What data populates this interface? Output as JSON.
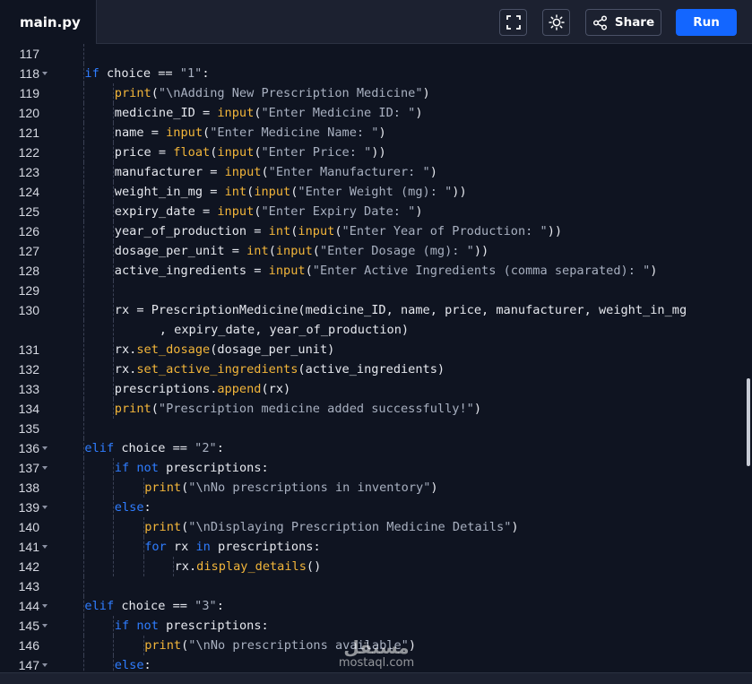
{
  "header": {
    "file_tab": "main.py",
    "share_label": "Share",
    "run_label": "Run",
    "icons": {
      "fullscreen": "fullscreen-icon",
      "theme": "sun-icon",
      "share": "share-icon"
    }
  },
  "colors": {
    "keyword": "#2f7dff",
    "function": "#f2b53a",
    "string": "#a8b0c0",
    "run_button": "#1366ff"
  },
  "watermark": {
    "logo": "مستقل",
    "text": "mostaql.com"
  },
  "code_lines": [
    {
      "n": "117",
      "fold": false,
      "indent": 1,
      "tokens": []
    },
    {
      "n": "118",
      "fold": true,
      "indent": 1,
      "tokens": [
        [
          "kw",
          "if"
        ],
        [
          "op",
          " choice == "
        ],
        [
          "st",
          "\"1\""
        ],
        [
          "op",
          ":"
        ]
      ]
    },
    {
      "n": "119",
      "fold": false,
      "indent": 2,
      "tokens": [
        [
          "fn",
          "print"
        ],
        [
          "op",
          "("
        ],
        [
          "st",
          "\"\\nAdding New Prescription Medicine\""
        ],
        [
          "op",
          ")"
        ]
      ]
    },
    {
      "n": "120",
      "fold": false,
      "indent": 2,
      "tokens": [
        [
          "op",
          "medicine_ID = "
        ],
        [
          "fn",
          "input"
        ],
        [
          "op",
          "("
        ],
        [
          "st",
          "\"Enter Medicine ID: \""
        ],
        [
          "op",
          ")"
        ]
      ]
    },
    {
      "n": "121",
      "fold": false,
      "indent": 2,
      "tokens": [
        [
          "op",
          "name = "
        ],
        [
          "fn",
          "input"
        ],
        [
          "op",
          "("
        ],
        [
          "st",
          "\"Enter Medicine Name: \""
        ],
        [
          "op",
          ")"
        ]
      ]
    },
    {
      "n": "122",
      "fold": false,
      "indent": 2,
      "tokens": [
        [
          "op",
          "price = "
        ],
        [
          "fn",
          "float"
        ],
        [
          "op",
          "("
        ],
        [
          "fn",
          "input"
        ],
        [
          "op",
          "("
        ],
        [
          "st",
          "\"Enter Price: \""
        ],
        [
          "op",
          "))"
        ]
      ]
    },
    {
      "n": "123",
      "fold": false,
      "indent": 2,
      "tokens": [
        [
          "op",
          "manufacturer = "
        ],
        [
          "fn",
          "input"
        ],
        [
          "op",
          "("
        ],
        [
          "st",
          "\"Enter Manufacturer: \""
        ],
        [
          "op",
          ")"
        ]
      ]
    },
    {
      "n": "124",
      "fold": false,
      "indent": 2,
      "tokens": [
        [
          "op",
          "weight_in_mg = "
        ],
        [
          "fn",
          "int"
        ],
        [
          "op",
          "("
        ],
        [
          "fn",
          "input"
        ],
        [
          "op",
          "("
        ],
        [
          "st",
          "\"Enter Weight (mg): \""
        ],
        [
          "op",
          "))"
        ]
      ]
    },
    {
      "n": "125",
      "fold": false,
      "indent": 2,
      "tokens": [
        [
          "op",
          "expiry_date = "
        ],
        [
          "fn",
          "input"
        ],
        [
          "op",
          "("
        ],
        [
          "st",
          "\"Enter Expiry Date: \""
        ],
        [
          "op",
          ")"
        ]
      ]
    },
    {
      "n": "126",
      "fold": false,
      "indent": 2,
      "tokens": [
        [
          "op",
          "year_of_production = "
        ],
        [
          "fn",
          "int"
        ],
        [
          "op",
          "("
        ],
        [
          "fn",
          "input"
        ],
        [
          "op",
          "("
        ],
        [
          "st",
          "\"Enter Year of Production: \""
        ],
        [
          "op",
          "))"
        ]
      ]
    },
    {
      "n": "127",
      "fold": false,
      "indent": 2,
      "tokens": [
        [
          "op",
          "dosage_per_unit = "
        ],
        [
          "fn",
          "int"
        ],
        [
          "op",
          "("
        ],
        [
          "fn",
          "input"
        ],
        [
          "op",
          "("
        ],
        [
          "st",
          "\"Enter Dosage (mg): \""
        ],
        [
          "op",
          "))"
        ]
      ]
    },
    {
      "n": "128",
      "fold": false,
      "indent": 2,
      "tokens": [
        [
          "op",
          "active_ingredients = "
        ],
        [
          "fn",
          "input"
        ],
        [
          "op",
          "("
        ],
        [
          "st",
          "\"Enter Active Ingredients (comma separated): \""
        ],
        [
          "op",
          ")"
        ]
      ]
    },
    {
      "n": "129",
      "fold": false,
      "indent": 2,
      "tokens": []
    },
    {
      "n": "130",
      "fold": false,
      "indent": 2,
      "tokens": [
        [
          "op",
          "rx = PrescriptionMedicine(medicine_ID, name, price, manufacturer, weight_in_mg"
        ]
      ]
    },
    {
      "n": "",
      "fold": false,
      "indent": 2,
      "wrap": true,
      "tokens": [
        [
          "op",
          ", expiry_date, year_of_production)"
        ]
      ]
    },
    {
      "n": "131",
      "fold": false,
      "indent": 2,
      "tokens": [
        [
          "op",
          "rx."
        ],
        [
          "fn",
          "set_dosage"
        ],
        [
          "op",
          "(dosage_per_unit)"
        ]
      ]
    },
    {
      "n": "132",
      "fold": false,
      "indent": 2,
      "tokens": [
        [
          "op",
          "rx."
        ],
        [
          "fn",
          "set_active_ingredients"
        ],
        [
          "op",
          "(active_ingredients)"
        ]
      ]
    },
    {
      "n": "133",
      "fold": false,
      "indent": 2,
      "tokens": [
        [
          "op",
          "prescriptions."
        ],
        [
          "fn",
          "append"
        ],
        [
          "op",
          "(rx)"
        ]
      ]
    },
    {
      "n": "134",
      "fold": false,
      "indent": 2,
      "tokens": [
        [
          "fn",
          "print"
        ],
        [
          "op",
          "("
        ],
        [
          "st",
          "\"Prescription medicine added successfully!\""
        ],
        [
          "op",
          ")"
        ]
      ]
    },
    {
      "n": "135",
      "fold": false,
      "indent": 1,
      "tokens": []
    },
    {
      "n": "136",
      "fold": true,
      "indent": 1,
      "tokens": [
        [
          "kw",
          "elif"
        ],
        [
          "op",
          " choice == "
        ],
        [
          "st",
          "\"2\""
        ],
        [
          "op",
          ":"
        ]
      ]
    },
    {
      "n": "137",
      "fold": true,
      "indent": 2,
      "tokens": [
        [
          "kw",
          "if"
        ],
        [
          "op",
          " "
        ],
        [
          "kw",
          "not"
        ],
        [
          "op",
          " prescriptions:"
        ]
      ]
    },
    {
      "n": "138",
      "fold": false,
      "indent": 3,
      "tokens": [
        [
          "fn",
          "print"
        ],
        [
          "op",
          "("
        ],
        [
          "st",
          "\"\\nNo prescriptions in inventory\""
        ],
        [
          "op",
          ")"
        ]
      ]
    },
    {
      "n": "139",
      "fold": true,
      "indent": 2,
      "tokens": [
        [
          "kw",
          "else"
        ],
        [
          "op",
          ":"
        ]
      ]
    },
    {
      "n": "140",
      "fold": false,
      "indent": 3,
      "tokens": [
        [
          "fn",
          "print"
        ],
        [
          "op",
          "("
        ],
        [
          "st",
          "\"\\nDisplaying Prescription Medicine Details\""
        ],
        [
          "op",
          ")"
        ]
      ]
    },
    {
      "n": "141",
      "fold": true,
      "indent": 3,
      "tokens": [
        [
          "kw",
          "for"
        ],
        [
          "op",
          " rx "
        ],
        [
          "kw",
          "in"
        ],
        [
          "op",
          " prescriptions:"
        ]
      ]
    },
    {
      "n": "142",
      "fold": false,
      "indent": 4,
      "tokens": [
        [
          "op",
          "rx."
        ],
        [
          "fn",
          "display_details"
        ],
        [
          "op",
          "()"
        ]
      ]
    },
    {
      "n": "143",
      "fold": false,
      "indent": 1,
      "tokens": []
    },
    {
      "n": "144",
      "fold": true,
      "indent": 1,
      "tokens": [
        [
          "kw",
          "elif"
        ],
        [
          "op",
          " choice == "
        ],
        [
          "st",
          "\"3\""
        ],
        [
          "op",
          ":"
        ]
      ]
    },
    {
      "n": "145",
      "fold": true,
      "indent": 2,
      "tokens": [
        [
          "kw",
          "if"
        ],
        [
          "op",
          " "
        ],
        [
          "kw",
          "not"
        ],
        [
          "op",
          " prescriptions:"
        ]
      ]
    },
    {
      "n": "146",
      "fold": false,
      "indent": 3,
      "tokens": [
        [
          "fn",
          "print"
        ],
        [
          "op",
          "("
        ],
        [
          "st",
          "\"\\nNo prescriptions available\""
        ],
        [
          "op",
          ")"
        ]
      ]
    },
    {
      "n": "147",
      "fold": true,
      "indent": 2,
      "tokens": [
        [
          "kw",
          "else"
        ],
        [
          "op",
          ":"
        ]
      ]
    }
  ]
}
